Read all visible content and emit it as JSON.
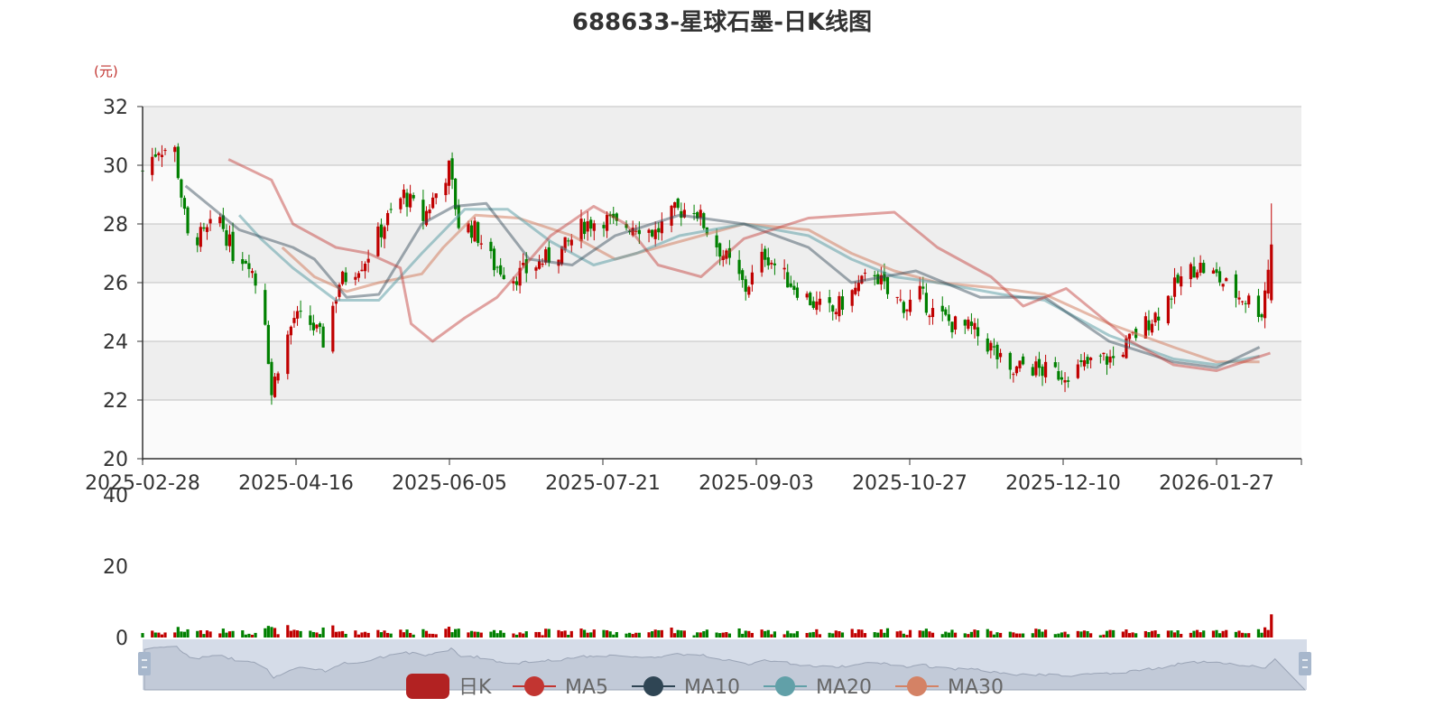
{
  "chart_data": {
    "type": "candlestick",
    "title": "688633-星球石墨-日K线图",
    "y_unit": "(元)",
    "ylim": [
      20,
      32
    ],
    "y_ticks": [
      "20",
      "22",
      "24",
      "26",
      "28",
      "30",
      "32"
    ],
    "x_tick_labels": [
      "2025-02-28",
      "2025-04-16",
      "2025-06-05",
      "2025-07-21",
      "2025-09-03",
      "2025-10-27",
      "2025-12-10",
      "2026-01-27"
    ],
    "volume_ylim": [
      0,
      40
    ],
    "volume_ticks": [
      "0",
      "20",
      "40"
    ],
    "legend": [
      {
        "name": "日K",
        "color": "#c23531"
      },
      {
        "name": "MA5",
        "color": "#c23531"
      },
      {
        "name": "MA10",
        "color": "#2f4554"
      },
      {
        "name": "MA20",
        "color": "#61a0a8"
      },
      {
        "name": "MA30",
        "color": "#d48265"
      }
    ],
    "colors": {
      "up": "#c00000",
      "down": "#008000"
    },
    "close_series": [
      [
        "2025-02-28",
        29.8
      ],
      [
        "2025-03-05",
        30.6
      ],
      [
        "2025-03-10",
        30.5
      ],
      [
        "2025-03-14",
        27.5
      ],
      [
        "2025-03-19",
        27.6
      ],
      [
        "2025-03-24",
        28.2
      ],
      [
        "2025-03-28",
        27.0
      ],
      [
        "2025-04-02",
        26.8
      ],
      [
        "2025-04-07",
        24.8
      ],
      [
        "2025-04-09",
        22.2
      ],
      [
        "2025-04-11",
        23.2
      ],
      [
        "2025-04-16",
        24.8
      ],
      [
        "2025-04-21",
        24.6
      ],
      [
        "2025-04-25",
        24.0
      ],
      [
        "2025-04-30",
        26.0
      ],
      [
        "2025-05-08",
        26.8
      ],
      [
        "2025-05-14",
        28.0
      ],
      [
        "2025-05-20",
        29.0
      ],
      [
        "2025-05-26",
        28.2
      ],
      [
        "2025-06-03",
        29.9
      ],
      [
        "2025-06-06",
        28.0
      ],
      [
        "2025-06-11",
        27.8
      ],
      [
        "2025-06-17",
        26.6
      ],
      [
        "2025-06-23",
        26.2
      ],
      [
        "2025-06-27",
        26.4
      ],
      [
        "2025-07-03",
        26.8
      ],
      [
        "2025-07-09",
        27.2
      ],
      [
        "2025-07-15",
        28.0
      ],
      [
        "2025-07-21",
        28.2
      ],
      [
        "2025-07-25",
        27.9
      ],
      [
        "2025-07-31",
        28.0
      ],
      [
        "2025-08-06",
        27.7
      ],
      [
        "2025-08-12",
        28.4
      ],
      [
        "2025-08-18",
        28.6
      ],
      [
        "2025-08-22",
        27.8
      ],
      [
        "2025-08-28",
        26.8
      ],
      [
        "2025-09-03",
        25.8
      ],
      [
        "2025-09-09",
        27.0
      ],
      [
        "2025-09-15",
        26.2
      ],
      [
        "2025-09-19",
        25.8
      ],
      [
        "2025-09-25",
        25.2
      ],
      [
        "2025-09-30",
        25.0
      ],
      [
        "2025-10-13",
        26.4
      ],
      [
        "2025-10-17",
        25.6
      ],
      [
        "2025-10-23",
        25.2
      ],
      [
        "2025-10-27",
        25.6
      ],
      [
        "2025-10-31",
        25.0
      ],
      [
        "2025-11-06",
        24.6
      ],
      [
        "2025-11-12",
        24.4
      ],
      [
        "2025-11-18",
        23.8
      ],
      [
        "2025-11-24",
        22.8
      ],
      [
        "2025-11-28",
        23.2
      ],
      [
        "2025-12-04",
        23.0
      ],
      [
        "2025-12-10",
        22.9
      ],
      [
        "2025-12-16",
        23.1
      ],
      [
        "2025-12-22",
        23.4
      ],
      [
        "2025-12-26",
        23.4
      ],
      [
        "2026-01-05",
        24.6
      ],
      [
        "2026-01-09",
        25.0
      ],
      [
        "2026-01-15",
        26.0
      ],
      [
        "2026-01-21",
        26.6
      ],
      [
        "2026-01-27",
        26.2
      ],
      [
        "2026-02-02",
        25.6
      ],
      [
        "2026-02-06",
        25.4
      ],
      [
        "2026-02-10",
        25.0
      ],
      [
        "2026-02-13",
        27.3
      ]
    ],
    "ma5_series": [
      [
        0.08,
        30.2
      ],
      [
        0.12,
        29.5
      ],
      [
        0.14,
        28.0
      ],
      [
        0.18,
        27.2
      ],
      [
        0.21,
        27.0
      ],
      [
        0.24,
        26.5
      ],
      [
        0.25,
        24.6
      ],
      [
        0.27,
        24.0
      ],
      [
        0.3,
        24.8
      ],
      [
        0.33,
        25.5
      ],
      [
        0.38,
        27.6
      ],
      [
        0.42,
        28.6
      ],
      [
        0.45,
        28.0
      ],
      [
        0.48,
        26.6
      ],
      [
        0.52,
        26.2
      ],
      [
        0.56,
        27.5
      ],
      [
        0.62,
        28.2
      ],
      [
        0.7,
        28.4
      ],
      [
        0.74,
        27.2
      ],
      [
        0.79,
        26.2
      ],
      [
        0.82,
        25.2
      ],
      [
        0.86,
        25.8
      ],
      [
        0.92,
        24.0
      ],
      [
        0.96,
        23.2
      ],
      [
        1.0,
        23.0
      ],
      [
        1.05,
        23.6
      ],
      [
        1.08,
        25.8
      ],
      [
        1.1,
        26.4
      ],
      [
        1.14,
        25.6
      ],
      [
        1.18,
        25.3
      ],
      [
        1.22,
        26.3
      ]
    ],
    "ma10_series": [
      [
        0.04,
        29.3
      ],
      [
        0.09,
        27.8
      ],
      [
        0.14,
        27.2
      ],
      [
        0.16,
        26.8
      ],
      [
        0.19,
        25.5
      ],
      [
        0.22,
        25.6
      ],
      [
        0.26,
        28.0
      ],
      [
        0.29,
        28.6
      ],
      [
        0.32,
        28.7
      ],
      [
        0.36,
        26.8
      ],
      [
        0.4,
        26.6
      ],
      [
        0.44,
        27.6
      ],
      [
        0.5,
        28.3
      ],
      [
        0.56,
        28.0
      ],
      [
        0.62,
        27.2
      ],
      [
        0.66,
        26.0
      ],
      [
        0.72,
        26.4
      ],
      [
        0.78,
        25.5
      ],
      [
        0.84,
        25.5
      ],
      [
        0.9,
        24.0
      ],
      [
        0.96,
        23.3
      ],
      [
        1.0,
        23.1
      ],
      [
        1.04,
        23.8
      ],
      [
        1.08,
        25.6
      ],
      [
        1.11,
        26.1
      ],
      [
        1.15,
        25.6
      ],
      [
        1.2,
        25.4
      ],
      [
        1.25,
        25.8
      ]
    ],
    "ma20_series": [
      [
        0.09,
        28.3
      ],
      [
        0.11,
        27.5
      ],
      [
        0.14,
        26.5
      ],
      [
        0.18,
        25.4
      ],
      [
        0.22,
        25.4
      ],
      [
        0.26,
        27.0
      ],
      [
        0.3,
        28.5
      ],
      [
        0.34,
        28.5
      ],
      [
        0.38,
        27.4
      ],
      [
        0.42,
        26.6
      ],
      [
        0.46,
        27.0
      ],
      [
        0.5,
        27.6
      ],
      [
        0.56,
        28.0
      ],
      [
        0.62,
        27.6
      ],
      [
        0.66,
        26.8
      ],
      [
        0.7,
        26.2
      ],
      [
        0.74,
        26.0
      ],
      [
        0.8,
        25.6
      ],
      [
        0.84,
        25.4
      ],
      [
        0.9,
        24.2
      ],
      [
        0.96,
        23.4
      ],
      [
        1.0,
        23.2
      ],
      [
        1.04,
        23.5
      ],
      [
        1.08,
        24.8
      ],
      [
        1.12,
        25.6
      ],
      [
        1.16,
        25.8
      ],
      [
        1.22,
        25.7
      ]
    ],
    "ma30_series": [
      [
        0.13,
        27.2
      ],
      [
        0.16,
        26.2
      ],
      [
        0.19,
        25.7
      ],
      [
        0.22,
        26.0
      ],
      [
        0.26,
        26.3
      ],
      [
        0.28,
        27.2
      ],
      [
        0.31,
        28.3
      ],
      [
        0.35,
        28.2
      ],
      [
        0.4,
        27.6
      ],
      [
        0.44,
        26.8
      ],
      [
        0.48,
        27.2
      ],
      [
        0.52,
        27.6
      ],
      [
        0.56,
        28.0
      ],
      [
        0.62,
        27.8
      ],
      [
        0.66,
        27.0
      ],
      [
        0.7,
        26.4
      ],
      [
        0.74,
        26.0
      ],
      [
        0.8,
        25.8
      ],
      [
        0.84,
        25.6
      ],
      [
        0.9,
        24.6
      ],
      [
        0.96,
        23.8
      ],
      [
        1.0,
        23.3
      ],
      [
        1.04,
        23.3
      ],
      [
        1.08,
        24.2
      ],
      [
        1.12,
        25.0
      ],
      [
        1.16,
        25.5
      ],
      [
        1.22,
        26.2
      ]
    ]
  }
}
